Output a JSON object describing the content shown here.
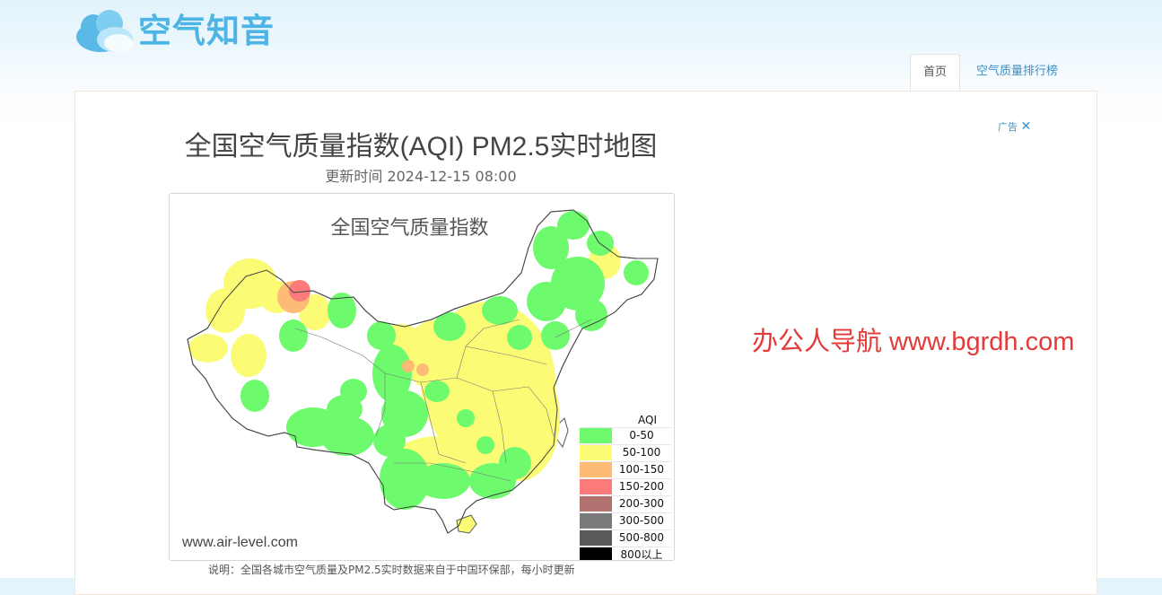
{
  "header": {
    "logo_text": "空气知音"
  },
  "nav": {
    "tabs": [
      {
        "label": "首页",
        "active": true
      },
      {
        "label": "空气质量排行榜",
        "active": false
      }
    ]
  },
  "main": {
    "title": "全国空气质量指数(AQI) PM2.5实时地图",
    "updated": "更新时间 2024-12-15 08:00",
    "ad_label": "广告",
    "watermark": "办公人导航 www.bgrdh.com",
    "note": "说明：全国各城市空气质量及PM2.5实时数据来自于中国环保部，每小时更新"
  },
  "map": {
    "title": "全国空气质量指数",
    "site": "www.air-level.com",
    "legend": {
      "title": "AQI",
      "items": [
        {
          "label": "0-50",
          "color": "#6dfa6d"
        },
        {
          "label": "50-100",
          "color": "#fbfb75"
        },
        {
          "label": "100-150",
          "color": "#fdbb76"
        },
        {
          "label": "150-200",
          "color": "#fd7b7b"
        },
        {
          "label": "200-300",
          "color": "#b2726f"
        },
        {
          "label": "300-500",
          "color": "#7a7a7a"
        },
        {
          "label": "500-800",
          "color": "#5a5a5a"
        },
        {
          "label": "800以上",
          "color": "#000000"
        }
      ]
    }
  }
}
